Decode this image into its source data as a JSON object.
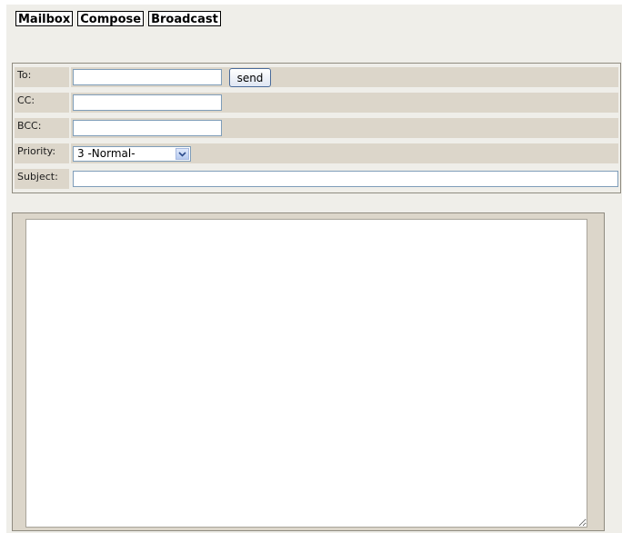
{
  "nav": {
    "mailbox": "Mailbox",
    "compose": "Compose",
    "broadcast": "Broadcast"
  },
  "form": {
    "to_label": "To:",
    "to_value": "",
    "send_label": "send",
    "cc_label": "CC:",
    "cc_value": "",
    "bcc_label": "BCC:",
    "bcc_value": "",
    "priority_label": "Priority:",
    "priority_value": "3 -Normal-",
    "subject_label": "Subject:",
    "subject_value": ""
  },
  "message": {
    "body": ""
  },
  "colors": {
    "page_bg": "#efeee9",
    "label_bg": "#dcd6ca",
    "input_border": "#7f9db9"
  },
  "icons": {
    "priority_dropdown": "chevron-down-icon"
  }
}
